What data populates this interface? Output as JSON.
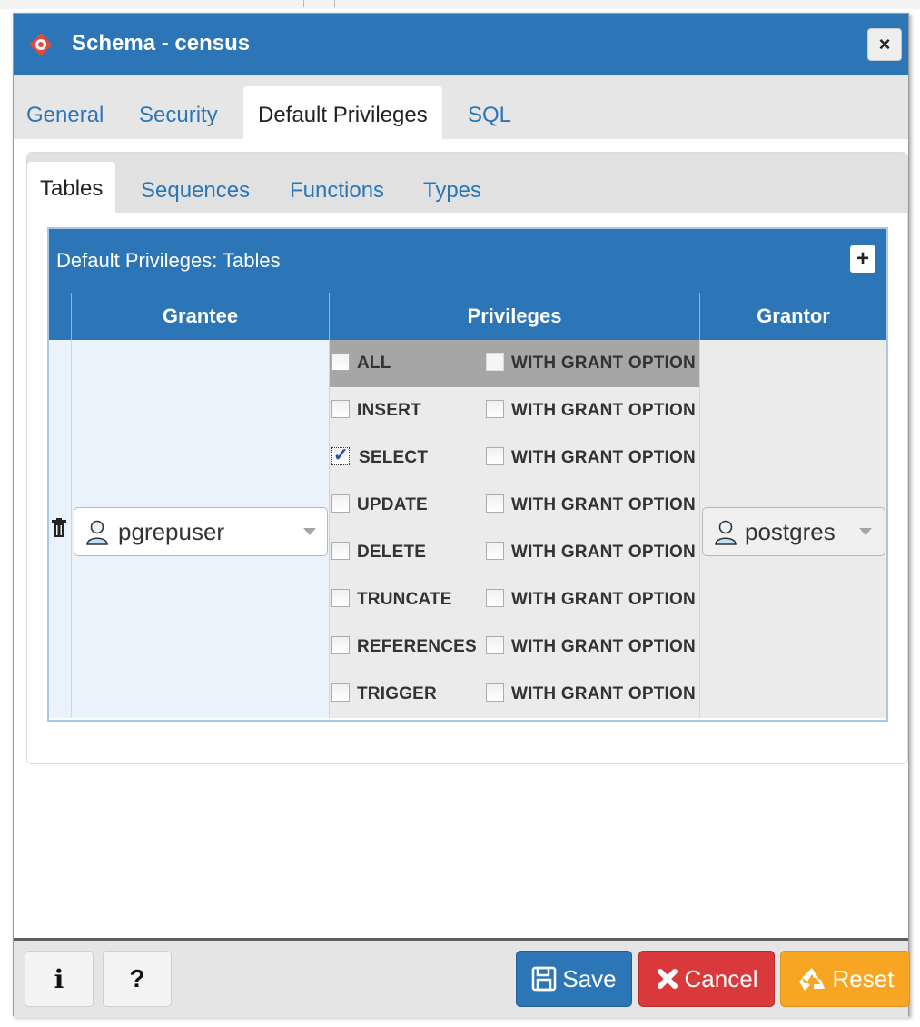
{
  "dialog": {
    "title": "Schema - census",
    "close_label": "×"
  },
  "main_tabs": [
    {
      "label": "General",
      "active": false
    },
    {
      "label": "Security",
      "active": false
    },
    {
      "label": "Default Privileges",
      "active": true
    },
    {
      "label": "SQL",
      "active": false
    }
  ],
  "sub_tabs": [
    {
      "label": "Tables",
      "active": true
    },
    {
      "label": "Sequences",
      "active": false
    },
    {
      "label": "Functions",
      "active": false
    },
    {
      "label": "Types",
      "active": false
    }
  ],
  "grid": {
    "title": "Default Privileges: Tables",
    "add_label": "+",
    "columns": [
      "Grantee",
      "Privileges",
      "Grantor"
    ],
    "row": {
      "grantee": "pgrepuser",
      "grantor": "postgres",
      "privileges": [
        {
          "name": "ALL",
          "checked": false,
          "grant_option": "WITH GRANT OPTION",
          "grant_checked": false
        },
        {
          "name": "INSERT",
          "checked": false,
          "grant_option": "WITH GRANT OPTION",
          "grant_checked": false
        },
        {
          "name": "SELECT",
          "checked": true,
          "grant_option": "WITH GRANT OPTION",
          "grant_checked": false
        },
        {
          "name": "UPDATE",
          "checked": false,
          "grant_option": "WITH GRANT OPTION",
          "grant_checked": false
        },
        {
          "name": "DELETE",
          "checked": false,
          "grant_option": "WITH GRANT OPTION",
          "grant_checked": false
        },
        {
          "name": "TRUNCATE",
          "checked": false,
          "grant_option": "WITH GRANT OPTION",
          "grant_checked": false
        },
        {
          "name": "REFERENCES",
          "checked": false,
          "grant_option": "WITH GRANT OPTION",
          "grant_checked": false
        },
        {
          "name": "TRIGGER",
          "checked": false,
          "grant_option": "WITH GRANT OPTION",
          "grant_checked": false
        }
      ]
    }
  },
  "footer": {
    "info_label": "i",
    "help_label": "?",
    "save_label": "Save",
    "cancel_label": "Cancel",
    "reset_label": "Reset"
  },
  "colors": {
    "primary": "#2c76b7",
    "cancel": "#d9393b",
    "reset": "#f6a623"
  },
  "icons": [
    "pgadmin-logo-icon",
    "close-icon",
    "add-icon",
    "trash-icon",
    "user-icon",
    "chevron-down-icon",
    "info-icon",
    "help-icon",
    "save-icon",
    "cancel-icon",
    "reset-icon"
  ]
}
